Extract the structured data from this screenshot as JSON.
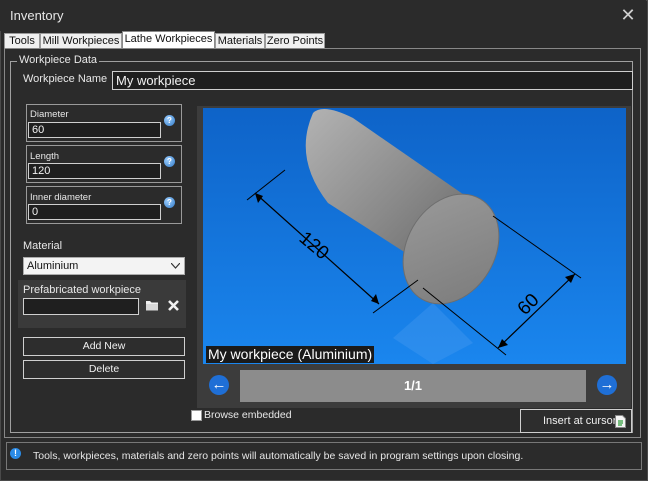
{
  "window": {
    "title": "Inventory"
  },
  "tabs": [
    {
      "label": "Tools"
    },
    {
      "label": "Mill Workpieces"
    },
    {
      "label": "Lathe Workpieces"
    },
    {
      "label": "Materials"
    },
    {
      "label": "Zero Points"
    }
  ],
  "active_tab": "Lathe Workpieces",
  "workpiece": {
    "group_title": "Workpiece Data",
    "name_label": "Workpiece Name",
    "name_value": "My workpiece",
    "diameter_label": "Diameter",
    "diameter_value": "60",
    "length_label": "Length",
    "length_value": "120",
    "inner_label": "Inner diameter",
    "inner_value": "0",
    "material_label": "Material",
    "material_value": "Aluminium",
    "prefab_label": "Prefabricated workpiece",
    "prefab_value": ""
  },
  "buttons": {
    "add_new": "Add New",
    "delete": "Delete",
    "insert": "Insert at cursor"
  },
  "preview": {
    "caption": "My workpiece (Aluminium)",
    "dim_length": "120",
    "dim_diameter": "60",
    "page": "1/1"
  },
  "browse_embedded_label": "Browse embedded",
  "browse_embedded_checked": false,
  "status": {
    "text": "Tools, workpieces, materials and zero points will automatically be saved in program settings upon closing."
  },
  "colors": {
    "background": "#2b2b2b",
    "accent": "#1f6fd6",
    "preview_bg": "#1a86ee"
  }
}
